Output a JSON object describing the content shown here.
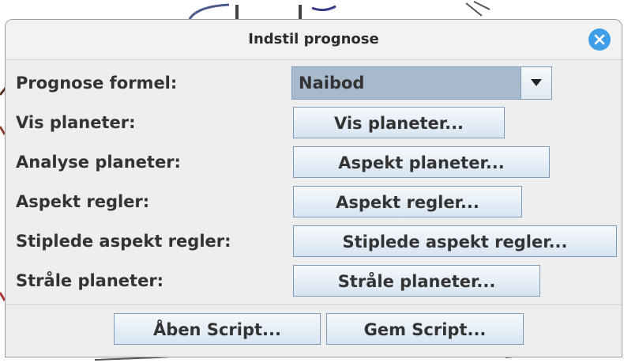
{
  "dialog": {
    "title": "Indstil prognose",
    "close_icon": "close-circle-icon"
  },
  "rows": [
    {
      "label": "Prognose formel:",
      "control": "combo",
      "value": "Naibod"
    },
    {
      "label": "Vis planeter:",
      "control": "button",
      "button_label": "Vis planeter..."
    },
    {
      "label": "Analyse planeter:",
      "control": "button",
      "button_label": "Aspekt planeter..."
    },
    {
      "label": "Aspekt regler:",
      "control": "button",
      "button_label": "Aspekt regler..."
    },
    {
      "label": "Stiplede aspekt regler:",
      "control": "button",
      "button_label": "Stiplede aspekt regler..."
    },
    {
      "label": "Stråle planeter:",
      "control": "button",
      "button_label": "Stråle planeter..."
    }
  ],
  "footer": {
    "open_script": "Åben Script...",
    "save_script": "Gem Script..."
  },
  "colors": {
    "accent": "#3f9ee8",
    "button_border": "#7f9db9",
    "combo_selected": "#a6b9cd",
    "dialog_bg": "#eeeeee"
  }
}
